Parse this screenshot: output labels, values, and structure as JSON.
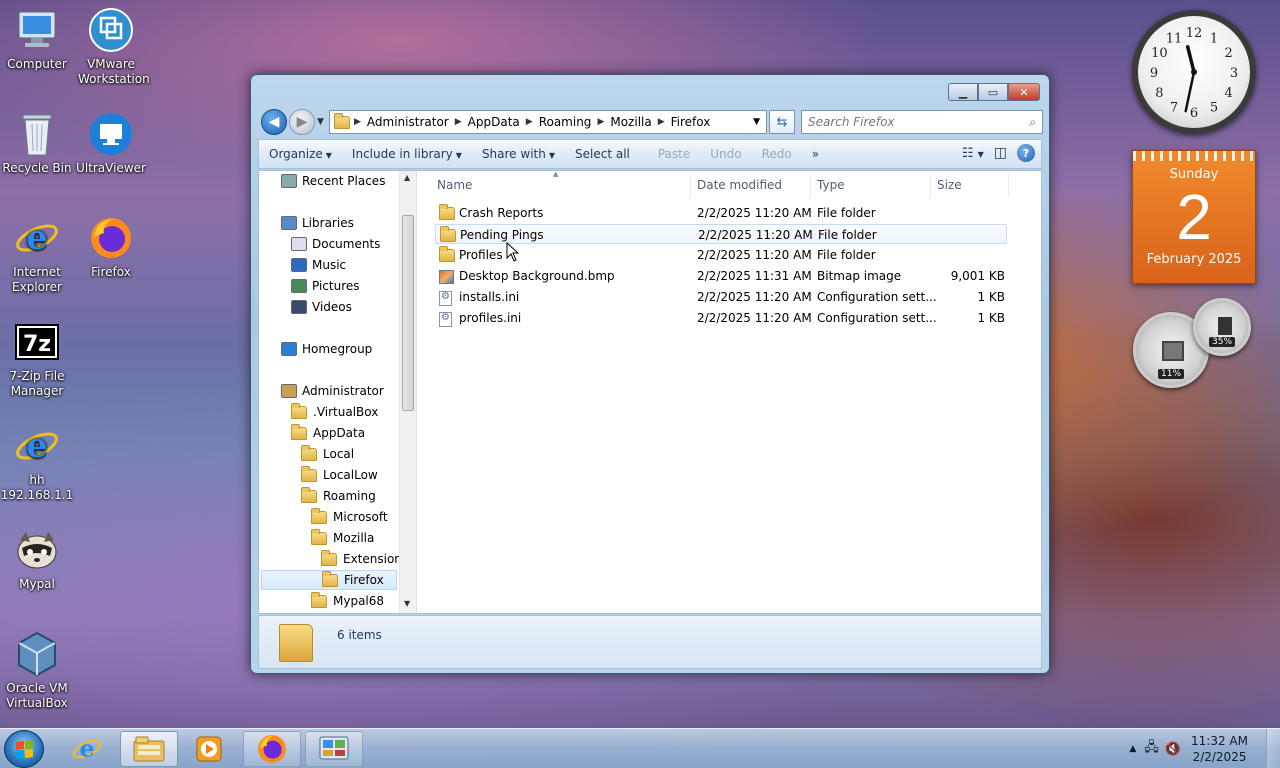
{
  "desktop": {
    "icons": [
      {
        "label": "Computer",
        "icon": "computer-icon"
      },
      {
        "label": "VMware Workstation",
        "icon": "vmware-icon"
      },
      {
        "label": "Recycle Bin",
        "icon": "recycle-bin-icon"
      },
      {
        "label": "UltraViewer",
        "icon": "ultraviewer-icon"
      },
      {
        "label": "Internet Explorer",
        "icon": "internet-explorer-icon"
      },
      {
        "label": "Firefox",
        "icon": "firefox-icon"
      },
      {
        "label": "7-Zip File Manager",
        "icon": "7zip-icon"
      },
      {
        "label": "hh 192.168.1.1",
        "icon": "internet-explorer-icon"
      },
      {
        "label": "Mypal",
        "icon": "mypal-icon"
      },
      {
        "label": "Oracle VM VirtualBox",
        "icon": "virtualbox-icon"
      }
    ]
  },
  "gadgets": {
    "clock": {
      "hour": 11,
      "minute": 32,
      "numbers": [
        "12",
        "1",
        "2",
        "3",
        "4",
        "5",
        "6",
        "7",
        "8",
        "9",
        "10",
        "11"
      ]
    },
    "calendar": {
      "weekday": "Sunday",
      "day": "2",
      "month": "February 2025"
    },
    "cpu_meter": {
      "cpu": "11%",
      "memory": "35%"
    }
  },
  "explorer": {
    "breadcrumb": [
      "Administrator",
      "AppData",
      "Roaming",
      "Mozilla",
      "Firefox"
    ],
    "search_placeholder": "Search Firefox",
    "toolbar": {
      "organize": "Organize",
      "include_in_library": "Include in library",
      "share_with": "Share with",
      "select_all": "Select all",
      "paste": "Paste",
      "undo": "Undo",
      "redo": "Redo",
      "more": "»"
    },
    "nav_tree": [
      {
        "label": "Recent Places",
        "indent": 0
      },
      {
        "label": "Libraries",
        "indent": 0
      },
      {
        "label": "Documents",
        "indent": 1
      },
      {
        "label": "Music",
        "indent": 1
      },
      {
        "label": "Pictures",
        "indent": 1
      },
      {
        "label": "Videos",
        "indent": 1
      },
      {
        "label": "Homegroup",
        "indent": 0
      },
      {
        "label": "Administrator",
        "indent": 0
      },
      {
        "label": ".VirtualBox",
        "indent": 1
      },
      {
        "label": "AppData",
        "indent": 1
      },
      {
        "label": "Local",
        "indent": 2
      },
      {
        "label": "LocalLow",
        "indent": 2
      },
      {
        "label": "Roaming",
        "indent": 2
      },
      {
        "label": "Microsoft",
        "indent": 3
      },
      {
        "label": "Mozilla",
        "indent": 3
      },
      {
        "label": "Extensions",
        "indent": 4
      },
      {
        "label": "Firefox",
        "indent": 4
      },
      {
        "label": "Mypal68",
        "indent": 3
      }
    ],
    "columns": {
      "name": "Name",
      "date_modified": "Date modified",
      "type": "Type",
      "size": "Size"
    },
    "files": [
      {
        "name": "Crash Reports",
        "date": "2/2/2025 11:20 AM",
        "type": "File folder",
        "size": "",
        "icon": "folder-icon"
      },
      {
        "name": "Pending Pings",
        "date": "2/2/2025 11:20 AM",
        "type": "File folder",
        "size": "",
        "icon": "folder-icon"
      },
      {
        "name": "Profiles",
        "date": "2/2/2025 11:20 AM",
        "type": "File folder",
        "size": "",
        "icon": "folder-icon"
      },
      {
        "name": "Desktop Background.bmp",
        "date": "2/2/2025 11:31 AM",
        "type": "Bitmap image",
        "size": "9,001 KB",
        "icon": "bitmap-file-icon"
      },
      {
        "name": "installs.ini",
        "date": "2/2/2025 11:20 AM",
        "type": "Configuration sett...",
        "size": "1 KB",
        "icon": "ini-file-icon"
      },
      {
        "name": "profiles.ini",
        "date": "2/2/2025 11:20 AM",
        "type": "Configuration sett...",
        "size": "1 KB",
        "icon": "ini-file-icon"
      }
    ],
    "status": "6 items"
  },
  "taskbar": {
    "time": "11:32 AM",
    "date": "2/2/2025"
  }
}
